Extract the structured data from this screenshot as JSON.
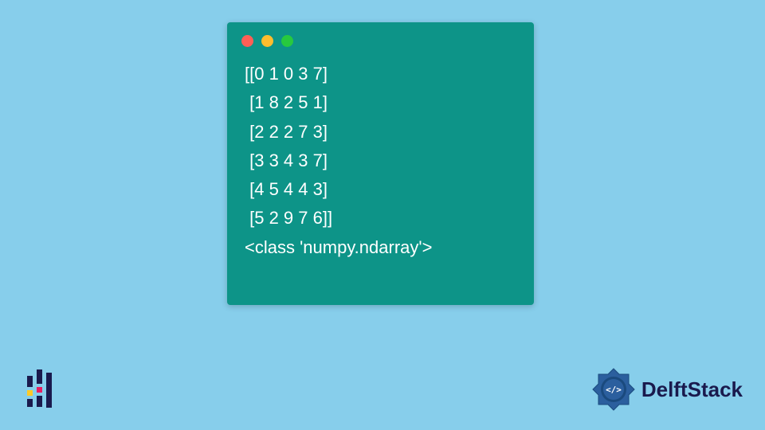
{
  "code_window": {
    "lines": [
      "[[0 1 0 3 7]",
      " [1 8 2 5 1]",
      " [2 2 2 7 3]",
      " [3 3 4 3 7]",
      " [4 5 4 4 3]",
      " [5 2 9 7 6]]",
      "<class 'numpy.ndarray'>"
    ]
  },
  "branding": {
    "name": "DelftStack"
  }
}
